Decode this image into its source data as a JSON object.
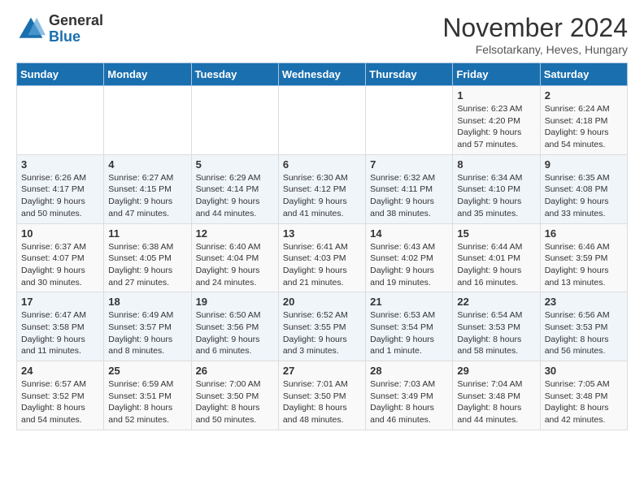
{
  "header": {
    "logo_general": "General",
    "logo_blue": "Blue",
    "month_title": "November 2024",
    "location": "Felsotarkany, Heves, Hungary"
  },
  "days_of_week": [
    "Sunday",
    "Monday",
    "Tuesday",
    "Wednesday",
    "Thursday",
    "Friday",
    "Saturday"
  ],
  "weeks": [
    [
      {
        "day": "",
        "info": ""
      },
      {
        "day": "",
        "info": ""
      },
      {
        "day": "",
        "info": ""
      },
      {
        "day": "",
        "info": ""
      },
      {
        "day": "",
        "info": ""
      },
      {
        "day": "1",
        "info": "Sunrise: 6:23 AM\nSunset: 4:20 PM\nDaylight: 9 hours\nand 57 minutes."
      },
      {
        "day": "2",
        "info": "Sunrise: 6:24 AM\nSunset: 4:18 PM\nDaylight: 9 hours\nand 54 minutes."
      }
    ],
    [
      {
        "day": "3",
        "info": "Sunrise: 6:26 AM\nSunset: 4:17 PM\nDaylight: 9 hours\nand 50 minutes."
      },
      {
        "day": "4",
        "info": "Sunrise: 6:27 AM\nSunset: 4:15 PM\nDaylight: 9 hours\nand 47 minutes."
      },
      {
        "day": "5",
        "info": "Sunrise: 6:29 AM\nSunset: 4:14 PM\nDaylight: 9 hours\nand 44 minutes."
      },
      {
        "day": "6",
        "info": "Sunrise: 6:30 AM\nSunset: 4:12 PM\nDaylight: 9 hours\nand 41 minutes."
      },
      {
        "day": "7",
        "info": "Sunrise: 6:32 AM\nSunset: 4:11 PM\nDaylight: 9 hours\nand 38 minutes."
      },
      {
        "day": "8",
        "info": "Sunrise: 6:34 AM\nSunset: 4:10 PM\nDaylight: 9 hours\nand 35 minutes."
      },
      {
        "day": "9",
        "info": "Sunrise: 6:35 AM\nSunset: 4:08 PM\nDaylight: 9 hours\nand 33 minutes."
      }
    ],
    [
      {
        "day": "10",
        "info": "Sunrise: 6:37 AM\nSunset: 4:07 PM\nDaylight: 9 hours\nand 30 minutes."
      },
      {
        "day": "11",
        "info": "Sunrise: 6:38 AM\nSunset: 4:05 PM\nDaylight: 9 hours\nand 27 minutes."
      },
      {
        "day": "12",
        "info": "Sunrise: 6:40 AM\nSunset: 4:04 PM\nDaylight: 9 hours\nand 24 minutes."
      },
      {
        "day": "13",
        "info": "Sunrise: 6:41 AM\nSunset: 4:03 PM\nDaylight: 9 hours\nand 21 minutes."
      },
      {
        "day": "14",
        "info": "Sunrise: 6:43 AM\nSunset: 4:02 PM\nDaylight: 9 hours\nand 19 minutes."
      },
      {
        "day": "15",
        "info": "Sunrise: 6:44 AM\nSunset: 4:01 PM\nDaylight: 9 hours\nand 16 minutes."
      },
      {
        "day": "16",
        "info": "Sunrise: 6:46 AM\nSunset: 3:59 PM\nDaylight: 9 hours\nand 13 minutes."
      }
    ],
    [
      {
        "day": "17",
        "info": "Sunrise: 6:47 AM\nSunset: 3:58 PM\nDaylight: 9 hours\nand 11 minutes."
      },
      {
        "day": "18",
        "info": "Sunrise: 6:49 AM\nSunset: 3:57 PM\nDaylight: 9 hours\nand 8 minutes."
      },
      {
        "day": "19",
        "info": "Sunrise: 6:50 AM\nSunset: 3:56 PM\nDaylight: 9 hours\nand 6 minutes."
      },
      {
        "day": "20",
        "info": "Sunrise: 6:52 AM\nSunset: 3:55 PM\nDaylight: 9 hours\nand 3 minutes."
      },
      {
        "day": "21",
        "info": "Sunrise: 6:53 AM\nSunset: 3:54 PM\nDaylight: 9 hours\nand 1 minute."
      },
      {
        "day": "22",
        "info": "Sunrise: 6:54 AM\nSunset: 3:53 PM\nDaylight: 8 hours\nand 58 minutes."
      },
      {
        "day": "23",
        "info": "Sunrise: 6:56 AM\nSunset: 3:53 PM\nDaylight: 8 hours\nand 56 minutes."
      }
    ],
    [
      {
        "day": "24",
        "info": "Sunrise: 6:57 AM\nSunset: 3:52 PM\nDaylight: 8 hours\nand 54 minutes."
      },
      {
        "day": "25",
        "info": "Sunrise: 6:59 AM\nSunset: 3:51 PM\nDaylight: 8 hours\nand 52 minutes."
      },
      {
        "day": "26",
        "info": "Sunrise: 7:00 AM\nSunset: 3:50 PM\nDaylight: 8 hours\nand 50 minutes."
      },
      {
        "day": "27",
        "info": "Sunrise: 7:01 AM\nSunset: 3:50 PM\nDaylight: 8 hours\nand 48 minutes."
      },
      {
        "day": "28",
        "info": "Sunrise: 7:03 AM\nSunset: 3:49 PM\nDaylight: 8 hours\nand 46 minutes."
      },
      {
        "day": "29",
        "info": "Sunrise: 7:04 AM\nSunset: 3:48 PM\nDaylight: 8 hours\nand 44 minutes."
      },
      {
        "day": "30",
        "info": "Sunrise: 7:05 AM\nSunset: 3:48 PM\nDaylight: 8 hours\nand 42 minutes."
      }
    ]
  ]
}
